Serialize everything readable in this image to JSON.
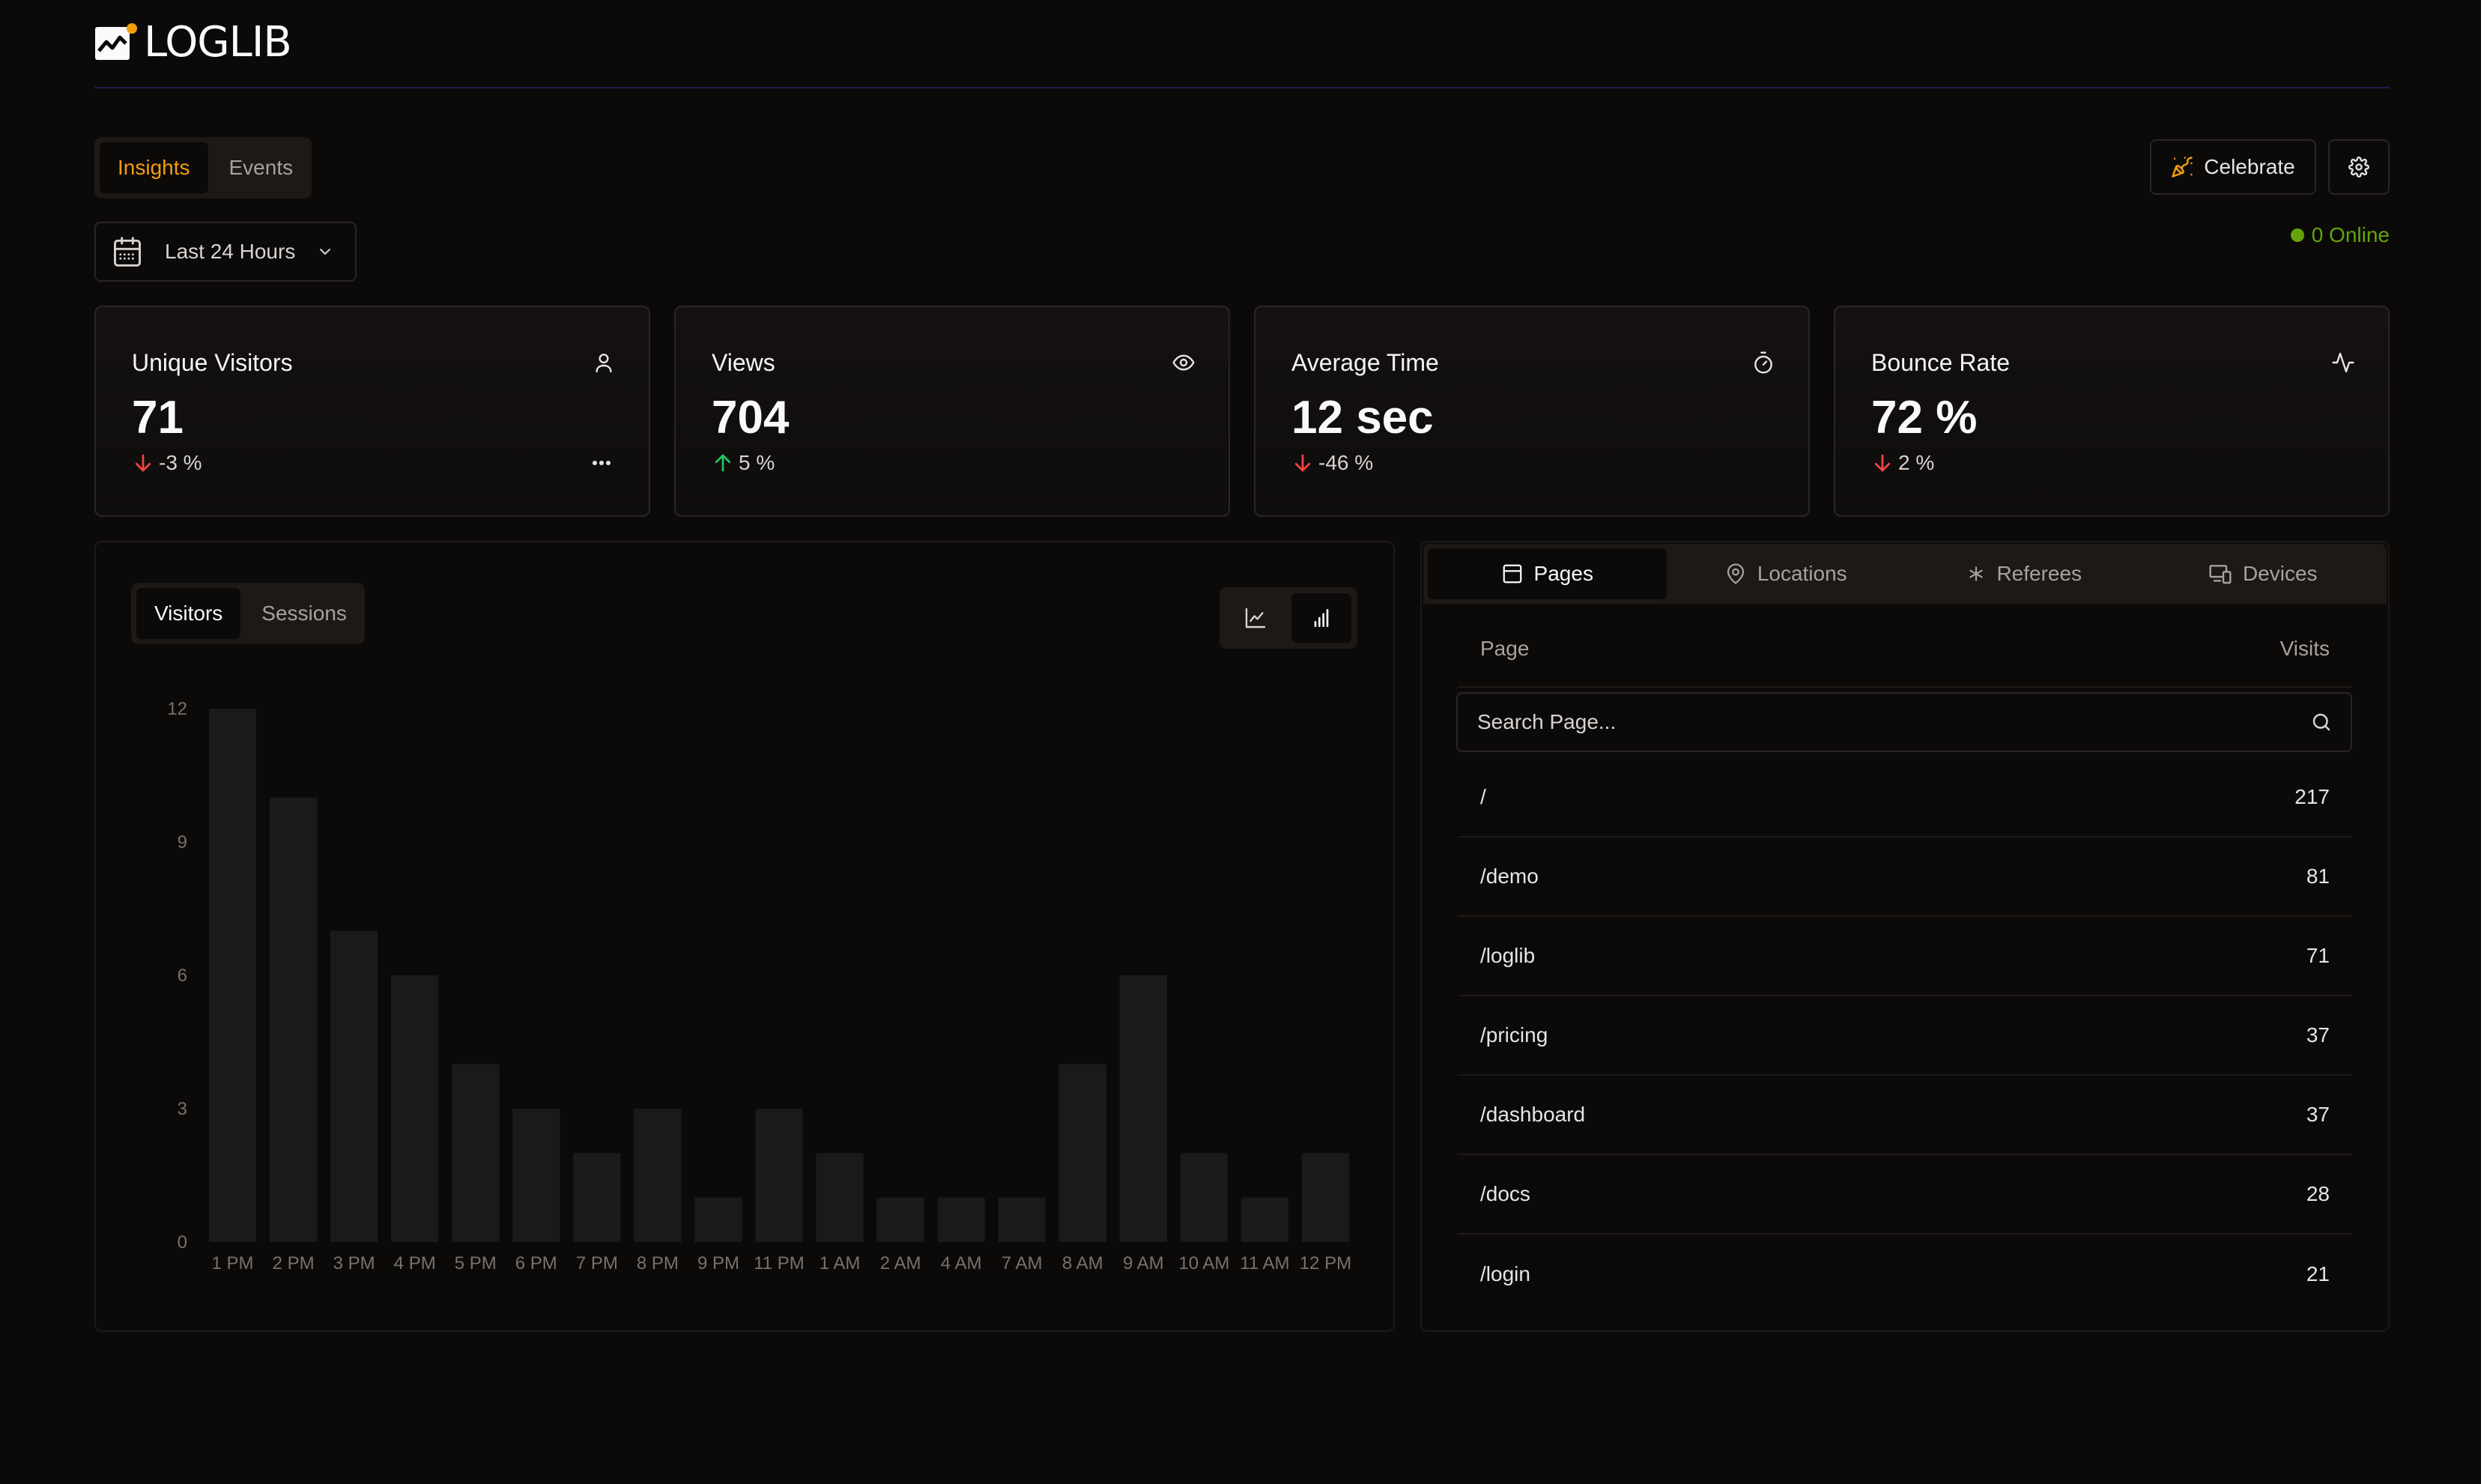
{
  "header": {
    "brand": "LOGLIB"
  },
  "main_tabs": [
    {
      "label": "Insights",
      "active": true
    },
    {
      "label": "Events",
      "active": false
    }
  ],
  "actions": {
    "celebrate_label": "Celebrate",
    "celebrate_icon": "party-popper-icon",
    "settings_icon": "gear-icon"
  },
  "range": {
    "label": "Last 24 Hours"
  },
  "online": {
    "label": "0 Online"
  },
  "stats": [
    {
      "title": "Unique Visitors",
      "value": "71",
      "change": "-3 %",
      "direction": "down",
      "icon": "user-icon"
    },
    {
      "title": "Views",
      "value": "704",
      "change": "5 %",
      "direction": "up",
      "icon": "eye-icon"
    },
    {
      "title": "Average Time",
      "value": "12 sec",
      "change": "-46 %",
      "direction": "down",
      "icon": "timer-icon"
    },
    {
      "title": "Bounce Rate",
      "value": "72 %",
      "change": "2 %",
      "direction": "down",
      "icon": "activity-icon"
    }
  ],
  "chart_tabs": [
    {
      "label": "Visitors",
      "active": true
    },
    {
      "label": "Sessions",
      "active": false
    }
  ],
  "chart_data": {
    "type": "bar",
    "categories": [
      "1 PM",
      "2 PM",
      "3 PM",
      "4 PM",
      "5 PM",
      "6 PM",
      "7 PM",
      "8 PM",
      "9 PM",
      "11 PM",
      "1 AM",
      "2 AM",
      "4 AM",
      "7 AM",
      "8 AM",
      "9 AM",
      "10 AM",
      "11 AM",
      "12 PM"
    ],
    "values": [
      12,
      10,
      7,
      6,
      4,
      3,
      2,
      3,
      1,
      3,
      2,
      1,
      1,
      1,
      4,
      6,
      2,
      1,
      2
    ],
    "yticks": [
      0,
      3,
      6,
      9,
      12
    ],
    "ylim": [
      0,
      12
    ],
    "bar_color": "#1c1a19"
  },
  "pages_tabs": [
    {
      "label": "Pages",
      "icon": "browser-window-icon",
      "active": true
    },
    {
      "label": "Locations",
      "icon": "map-pin-icon",
      "active": false
    },
    {
      "label": "Referees",
      "icon": "asterisk-icon",
      "active": false
    },
    {
      "label": "Devices",
      "icon": "devices-icon",
      "active": false
    }
  ],
  "pages_table": {
    "col_page": "Page",
    "col_visits": "Visits",
    "search_placeholder": "Search Page...",
    "rows": [
      {
        "page": "/",
        "visits": "217"
      },
      {
        "page": "/demo",
        "visits": "81"
      },
      {
        "page": "/loglib",
        "visits": "71"
      },
      {
        "page": "/pricing",
        "visits": "37"
      },
      {
        "page": "/dashboard",
        "visits": "37"
      },
      {
        "page": "/docs",
        "visits": "28"
      },
      {
        "page": "/login",
        "visits": "21"
      }
    ]
  },
  "colors": {
    "accent": "#f59e0b",
    "up": "#22c55e",
    "down": "#ef4444",
    "online": "#65a30d"
  }
}
